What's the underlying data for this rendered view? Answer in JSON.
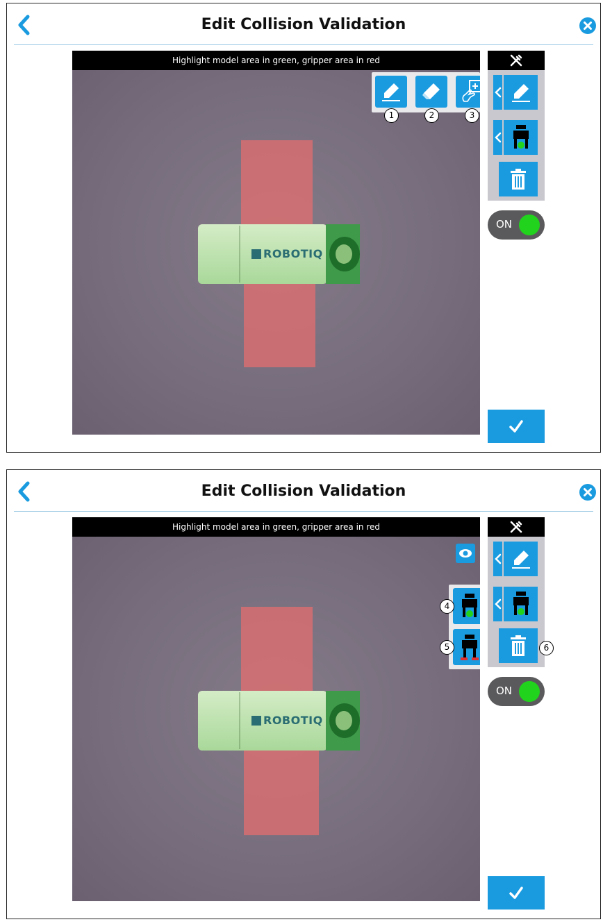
{
  "header": {
    "title": "Edit Collision Validation",
    "back_icon": "chevron-left-icon",
    "close_icon": "close-circle-icon"
  },
  "camera": {
    "banner": "Highlight model area in green, gripper area in red",
    "logo_text": "ROBOTIQ"
  },
  "panel1": {
    "tools": [
      {
        "name": "marker-icon",
        "callout": "1"
      },
      {
        "name": "eraser-icon",
        "callout": "2"
      },
      {
        "name": "touch-add-icon",
        "callout": "3"
      }
    ]
  },
  "panel2": {
    "eye_icon": "eye-icon",
    "grippers": [
      {
        "name": "gripper-green-icon",
        "callout": "4"
      },
      {
        "name": "gripper-red-icon",
        "callout": "5"
      }
    ],
    "trash_callout": "6"
  },
  "sidebar": {
    "header_icon": "tools-icon",
    "toggle_label": "ON"
  },
  "colors": {
    "accent": "#1a9be0",
    "toggle_on": "#22d31d",
    "gripper_area": "#e86e6e",
    "model_area": "#3f9a4a"
  }
}
